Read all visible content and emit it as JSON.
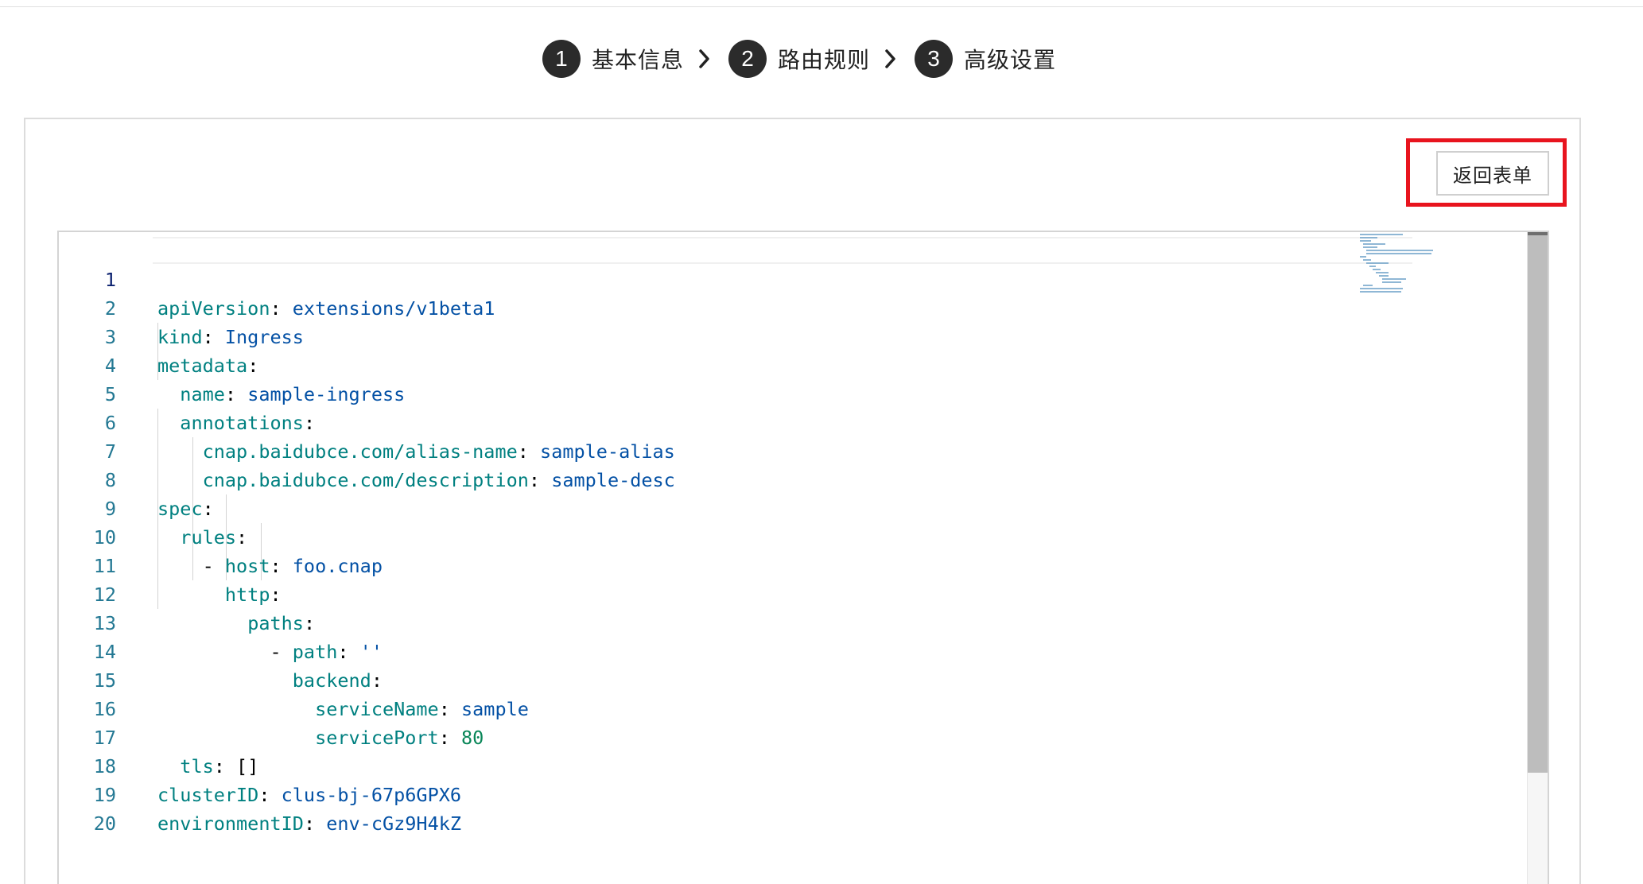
{
  "steps": [
    {
      "number": "1",
      "label": "基本信息"
    },
    {
      "number": "2",
      "label": "路由规则"
    },
    {
      "number": "3",
      "label": "高级设置"
    }
  ],
  "toolbar": {
    "back_to_form_label": "返回表单"
  },
  "editor": {
    "lines": [
      {
        "no": "1",
        "key": "apiVersion",
        "value": "extensions/v1beta1"
      },
      {
        "no": "2",
        "key": "kind",
        "value": "Ingress"
      },
      {
        "no": "3",
        "key": "metadata",
        "value": ""
      },
      {
        "no": "4",
        "key": "name",
        "value": "sample-ingress"
      },
      {
        "no": "5",
        "key": "annotations",
        "value": ""
      },
      {
        "no": "6",
        "key": "cnap.baidubce.com/alias-name",
        "value": "sample-alias"
      },
      {
        "no": "7",
        "key": "cnap.baidubce.com/description",
        "value": "sample-desc"
      },
      {
        "no": "8",
        "key": "spec",
        "value": ""
      },
      {
        "no": "9",
        "key": "rules",
        "value": ""
      },
      {
        "no": "10",
        "key": "host",
        "value": "foo.cnap"
      },
      {
        "no": "11",
        "key": "http",
        "value": ""
      },
      {
        "no": "12",
        "key": "paths",
        "value": ""
      },
      {
        "no": "13",
        "key": "path",
        "value": "''"
      },
      {
        "no": "14",
        "key": "backend",
        "value": ""
      },
      {
        "no": "15",
        "key": "serviceName",
        "value": "sample"
      },
      {
        "no": "16",
        "key": "servicePort",
        "value": "80"
      },
      {
        "no": "17",
        "key": "tls",
        "value": "[]"
      },
      {
        "no": "18",
        "key": "clusterID",
        "value": "clus-bj-67p6GPX6"
      },
      {
        "no": "19",
        "key": "environmentID",
        "value": "env-cGz9H4kZ"
      },
      {
        "no": "20",
        "key": "",
        "value": ""
      }
    ]
  },
  "colors": {
    "highlight_border": "#e8141e",
    "yaml_key": "#008080",
    "yaml_value": "#0451a5",
    "yaml_number": "#098658",
    "line_number": "#237893"
  }
}
